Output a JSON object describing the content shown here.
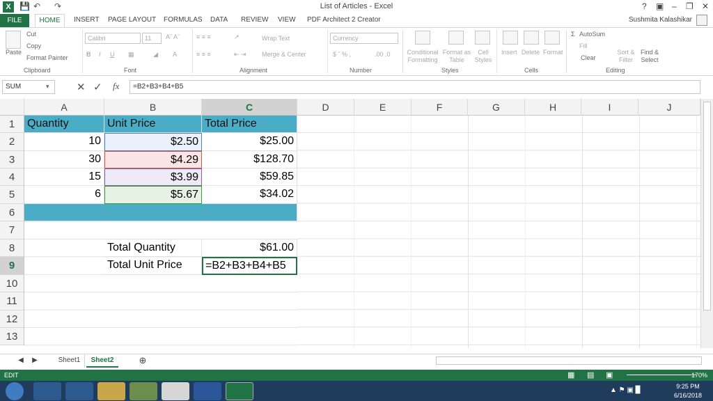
{
  "window": {
    "title": "List of Articles - Excel",
    "user": "Sushmita Kalashikar"
  },
  "tabs": [
    "FILE",
    "HOME",
    "INSERT",
    "PAGE LAYOUT",
    "FORMULAS",
    "DATA",
    "REVIEW",
    "VIEW",
    "PDF Architect 2 Creator"
  ],
  "ribbon": {
    "clipboard": {
      "paste": "Paste",
      "cut": "Cut",
      "copy": "Copy",
      "format_painter": "Format Painter",
      "label": "Clipboard"
    },
    "font": {
      "name": "Calibri",
      "size": "11",
      "label": "Font"
    },
    "alignment": {
      "wrap": "Wrap Text",
      "merge": "Merge & Center",
      "label": "Alignment"
    },
    "number": {
      "format": "Currency",
      "label": "Number"
    },
    "styles": {
      "conditional": "Conditional Formatting",
      "format_table": "Format as Table",
      "cell_styles": "Cell Styles",
      "label": "Styles"
    },
    "cells": {
      "insert": "Insert",
      "delete": "Delete",
      "format": "Format",
      "label": "Cells"
    },
    "editing": {
      "autosum": "AutoSum",
      "fill": "Fill",
      "clear": "Clear",
      "sort": "Sort & Filter",
      "find": "Find & Select",
      "label": "Editing"
    }
  },
  "formula_bar": {
    "name_box": "SUM",
    "formula": "=B2+B3+B4+B5",
    "fx": "fx"
  },
  "columns": [
    "A",
    "B",
    "C",
    "D",
    "E",
    "F",
    "G",
    "H",
    "I",
    "J"
  ],
  "rows": [
    "1",
    "2",
    "3",
    "4",
    "5",
    "6",
    "7",
    "8",
    "9",
    "10",
    "11",
    "12",
    "13"
  ],
  "cells": {
    "A1": "Quantity",
    "B1": "Unit Price",
    "C1": "Total Price",
    "A2": "10",
    "B2": "$2.50",
    "C2": "$25.00",
    "A3": "30",
    "B3": "$4.29",
    "C3": "$128.70",
    "A4": "15",
    "B4": "$3.99",
    "C4": "$59.85",
    "A5": "6",
    "B5": "$5.67",
    "C5": "$34.02",
    "B8": "Total Quantity",
    "C8": "$61.00",
    "B9": "Total Unit Price",
    "C9": "=B2+B3+B4+B5"
  },
  "sheets": [
    "Sheet1",
    "Sheet2"
  ],
  "status": {
    "mode": "EDIT",
    "zoom": "170%"
  },
  "taskbar": {
    "time": "9:25 PM",
    "date": "6/16/2018"
  },
  "colors": {
    "excel_green": "#217346",
    "header_fill": "#4bacc6"
  }
}
